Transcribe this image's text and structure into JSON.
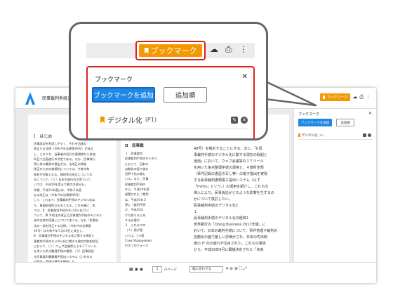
{
  "app": {
    "doc_title": "民事裁判手続きの",
    "brand_color": "#1e88e5",
    "bookmark_color": "#f39800",
    "highlight_color": "#e02020"
  },
  "toolbar": {
    "bookmark_label": "ブックマーク",
    "icons": [
      "cloud-download-icon",
      "print-icon",
      "more-vert-icon"
    ]
  },
  "panel": {
    "title": "ブックマーク",
    "add_button": "ブックマークを追加",
    "sort_button": "追加順",
    "items": [
      {
        "label": "デジタル化",
        "page": "(P1)"
      }
    ]
  },
  "left_page": {
    "heading": "Ⅰ　はじめ",
    "lines": [
      "民事訴訟を利用しやすく、それを迅速な",
      "改正する法律（令和４年法律第48号）が成立",
      "し、このうち、当事者の双方が遠隔地から参加",
      "同日で全面施行の予定である。なお、民事執行",
      "等に係る書面の提出方法、法改正の規定",
      "改正のための諸規則については、今後令和",
      "条約が対象となる。規則等の改正についての",
      "るについて、（１）日本の発行の文章ついて",
      "いては、平成30年度まで最大の部分も。",
      "作戦、平成31年度には、令和３年度",
      "なる改正は（令和４年法律第48号）",
      "して、これまで、民事裁判手続のデジタル化は",
      "た、事務処理的なものとなる。これを機に、本",
      "では、Ⅱ　民事裁判手続のデジタル化 Ⅱ に",
      "ついて、Ⅲ 手続法の改正と民事裁判手続のデジタル",
      "化の全体の見通しについて述べる。なお「民事訴",
      "法の一部を改正する法律」（令和４年法律第",
      "48号）は令和４年５月18日に成立し、",
      "Ⅱ　民事裁判手続のデジタル化に関する現状と",
      "事裁判手続のデジタル化に関する検討の取組状況",
      "において、（１）ウェブ会議等によるＩＴツール",
      "を用いた争点整理手続の運用、（２）民事訴訟",
      "る民事裁判書類電子提出システム（いわゆる",
      "の受付・管理の運用を開始した。"
    ]
  },
  "mid_page": {
    "heading": "Ⅱ　民事裁",
    "lines_left": [
      "１　民事裁判",
      "",
      "民事裁判手続のデジタル",
      "において、日本の",
      "自動化の面で後れ",
      "世界で化の進む",
      "いる。また、民事",
      "民事裁判手続の",
      "から、平成29年度",
      "設置された「裁判",
      "は、平成30年３",
      "等に（裁判手続",
      "け、平成30年",
      "けた取りまとめ",
      "する必要が",
      "２　これまでの",
      "（１）我が国",
      "いては、①e提",
      "Case Managemen",
      "の三つのフェーズ"
    ],
    "lines_right": [
      "48号）を制定することにする。次に、「Ⅱ 民",
      "事裁判手続のデジタル化に関する現在の取組と",
      "運用」において、ウェブ会議等のＩＴツール",
      "を用いた争点整理手続の運用と、４箇所全部",
      "（事件記録の書証の写し等）の電子提出を実現",
      "する民事裁判書類電子提出システム（以下",
      "「mints」という。）の運用を紹介し、これらの",
      "導入により、民事訴訟がどのような影響を生ずるの",
      "かについて検討したい。",
      "民事裁判手続のデジタル化2",
      "１",
      "民事裁判手続のデジタル化の経緯1",
      "世界銀行の「Doing Business 2017年版」に",
      "おいて、日本の裁判手続について、事件管理や裁判の",
      "自動化の面で厳しい評価がされ、日本の司法制",
      "度の IT 化の遅れが注目された。これらの事情",
      "から、平成29年6月に閣議決定された「未来"
    ]
  },
  "sidebar": {
    "title": "ブックマーク",
    "add_button": "ブックマークを追加",
    "sort_button": "追加順",
    "item_label": "デジタル化",
    "item_page": "(P1)"
  },
  "bottom_bar": {
    "page_value": "1",
    "page_total": "/1ページ",
    "zoom_label": "幅に合わせる"
  }
}
